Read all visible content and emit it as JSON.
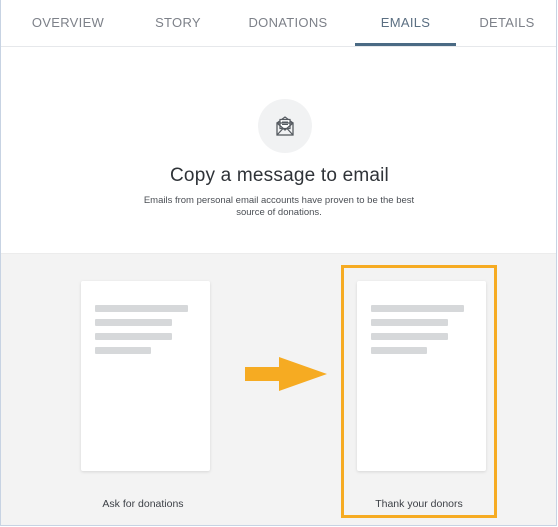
{
  "tabs": [
    {
      "label": "OVERVIEW",
      "active": false
    },
    {
      "label": "STORY",
      "active": false
    },
    {
      "label": "DONATIONS",
      "active": false
    },
    {
      "label": "EMAILS",
      "active": true
    },
    {
      "label": "DETAILS",
      "active": false
    }
  ],
  "hero": {
    "icon": "envelope-icon",
    "title": "Copy a message to email",
    "subtitle": "Emails from personal email accounts have proven to be the best source of donations."
  },
  "templates": [
    {
      "label": "Ask for donations",
      "highlighted": false
    },
    {
      "label": "Thank your donors",
      "highlighted": true
    }
  ],
  "annotation": {
    "arrow_icon": "arrow-right-icon",
    "highlight_color": "#f6ab22"
  },
  "colors": {
    "active_tab_underline": "#4a6a84",
    "lower_background": "#f3f3f3"
  }
}
